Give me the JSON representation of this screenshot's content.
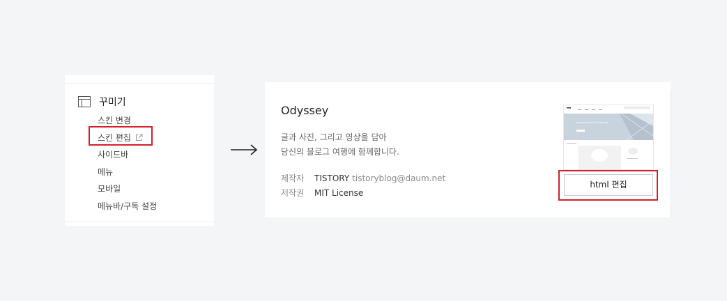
{
  "sidebar": {
    "header": {
      "title": "꾸미기",
      "icon": "layout-icon"
    },
    "items": [
      {
        "label": "스킨 변경"
      },
      {
        "label": "스킨 편집",
        "icon": "external-link-icon",
        "highlighted": true
      },
      {
        "label": "사이드바"
      },
      {
        "label": "메뉴"
      },
      {
        "label": "모바일"
      },
      {
        "label": "메뉴바/구독 설정"
      }
    ]
  },
  "arrow": {
    "icon": "right-arrow-icon"
  },
  "skin": {
    "name": "Odyssey",
    "description_line1": "글과 사진, 그리고 영상을 담아",
    "description_line2": "당신의 블로그 여행에 함께합니다.",
    "author_label": "제작자",
    "author_name": "TISTORY",
    "author_email": "tistoryblog@daum.net",
    "license_label": "저작권",
    "license_value": "MIT License",
    "thumbnail_hero_text": "Welcome to the 1st Odyssey",
    "html_edit_label": "html 편집"
  },
  "colors": {
    "highlight": "#d32029",
    "background": "#f4f5f7"
  }
}
